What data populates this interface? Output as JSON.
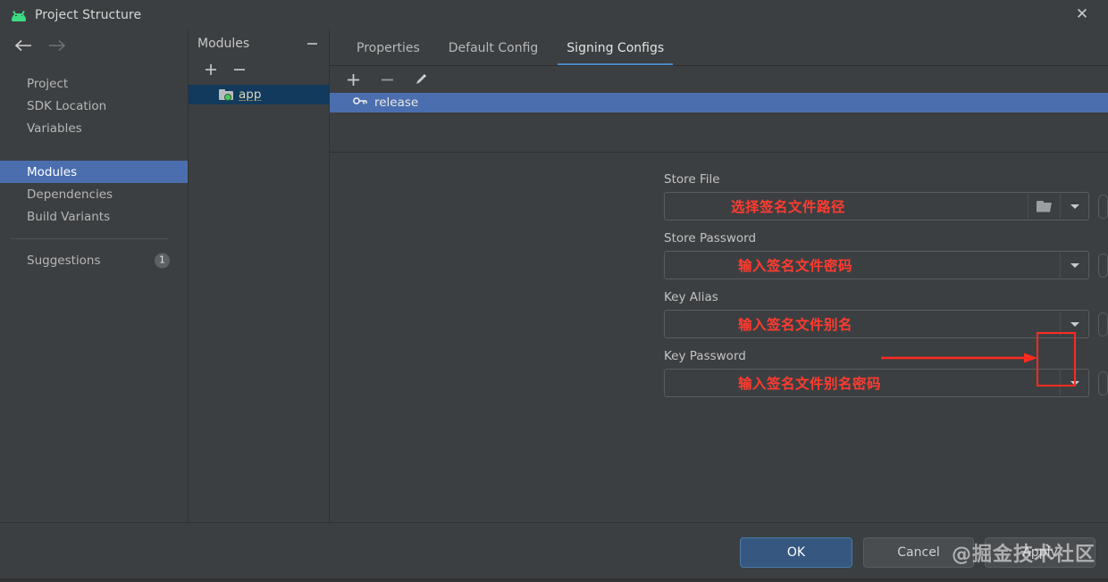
{
  "window": {
    "title": "Project Structure",
    "app_icon": "android-icon",
    "close_icon": "close-icon"
  },
  "nav": {
    "back_icon": "arrow-left-icon",
    "forward_icon": "arrow-right-icon",
    "items": [
      {
        "label": "Project",
        "selected": false
      },
      {
        "label": "SDK Location",
        "selected": false
      },
      {
        "label": "Variables",
        "selected": false
      },
      {
        "label": "Modules",
        "selected": true
      },
      {
        "label": "Dependencies",
        "selected": false
      },
      {
        "label": "Build Variants",
        "selected": false
      }
    ],
    "suggestions": {
      "label": "Suggestions",
      "count": "1"
    }
  },
  "modules": {
    "header": "Modules",
    "collapse_icon": "minus-icon",
    "add_icon": "plus-icon",
    "remove_icon": "minus-icon",
    "items": [
      {
        "label": "app",
        "icon": "module-folder-icon",
        "selected": true
      }
    ]
  },
  "tabs": [
    {
      "label": "Properties",
      "active": false
    },
    {
      "label": "Default Config",
      "active": false
    },
    {
      "label": "Signing Configs",
      "active": true
    }
  ],
  "configs": {
    "add_icon": "plus-icon",
    "remove_icon": "minus-icon",
    "edit_icon": "pencil-icon",
    "items": [
      {
        "label": "release",
        "icon": "key-icon",
        "selected": true
      }
    ]
  },
  "form": {
    "fields": [
      {
        "label": "Store File",
        "value": "选择签名文件路径",
        "has_browse": true,
        "browse_icon": "folder-open-icon",
        "dropdown_icon": "chevron-down-icon",
        "extra_icon": "variable-button-icon"
      },
      {
        "label": "Store Password",
        "value": "输入签名文件密码",
        "has_browse": false,
        "dropdown_icon": "chevron-down-icon",
        "extra_icon": "variable-button-icon"
      },
      {
        "label": "Key Alias",
        "value": "输入签名文件别名",
        "has_browse": false,
        "dropdown_icon": "chevron-down-icon",
        "extra_icon": "variable-button-icon"
      },
      {
        "label": "Key Password",
        "value": "输入签名文件别名密码",
        "has_browse": false,
        "dropdown_icon": "chevron-down-icon",
        "extra_icon": "variable-button-icon"
      }
    ]
  },
  "annotation": {
    "arrow_color": "#ff2b20",
    "box_color": "#ff2b20",
    "target": "store-file-browse-button"
  },
  "footer": {
    "ok_label": "OK",
    "cancel_label": "Cancel",
    "apply_label": "Apply",
    "watermark": "@掘金技术社区"
  },
  "colors": {
    "background": "#3c3f41",
    "selection_blue": "#4b6eaf",
    "selection_navy": "#113a5c",
    "accent_underline": "#4a88c7",
    "annotation_red": "#ff3b30",
    "primary_button": "#365880"
  }
}
